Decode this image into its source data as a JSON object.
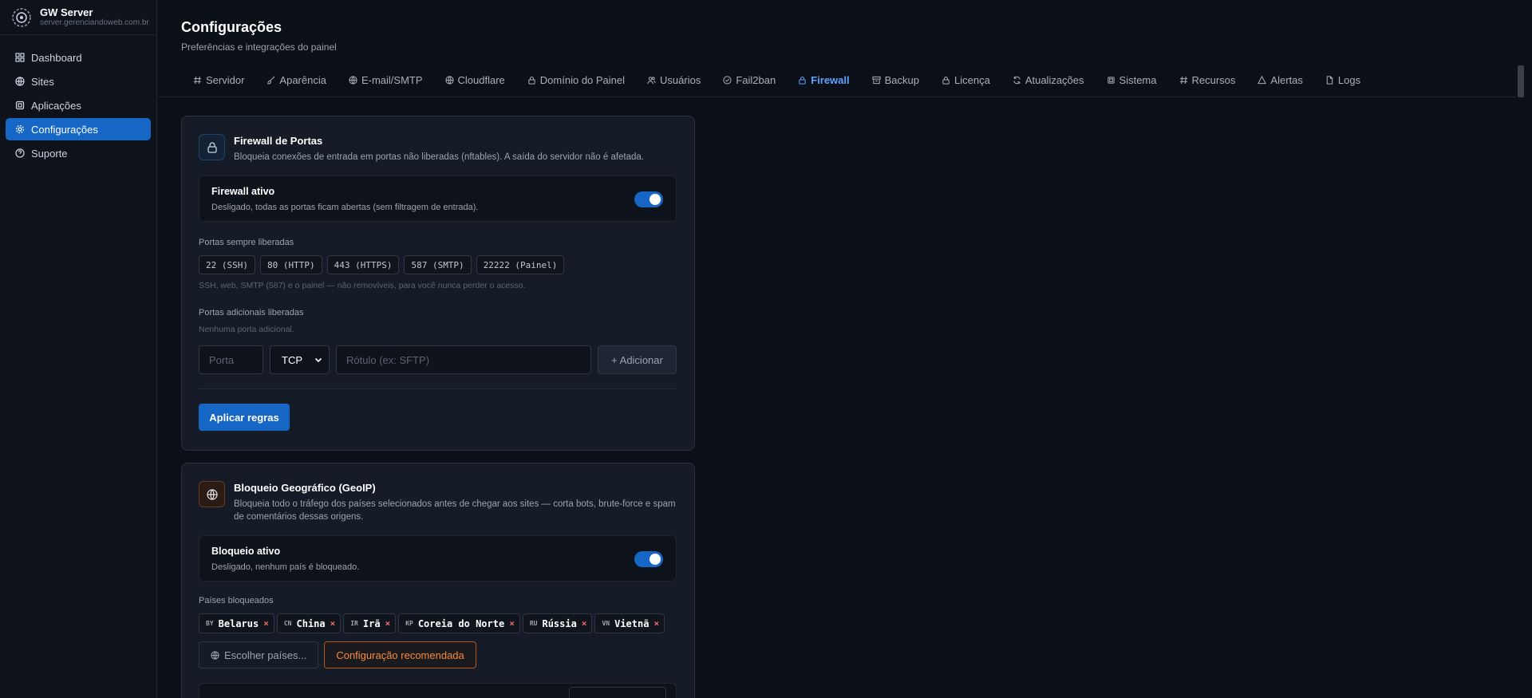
{
  "brand": {
    "name": "GW Server",
    "host": "server.gerenciandoweb.com.br"
  },
  "nav": [
    {
      "label": "Dashboard",
      "icon": "grid-icon",
      "active": false
    },
    {
      "label": "Sites",
      "icon": "globe-icon",
      "active": false
    },
    {
      "label": "Aplicações",
      "icon": "box-icon",
      "active": false
    },
    {
      "label": "Configurações",
      "icon": "gear-icon",
      "active": true
    },
    {
      "label": "Suporte",
      "icon": "help-icon",
      "active": false
    }
  ],
  "header": {
    "title": "Configurações",
    "subtitle": "Preferências e integrações do painel"
  },
  "tabs": [
    {
      "label": "Servidor",
      "icon": "hash-icon"
    },
    {
      "label": "Aparência",
      "icon": "brush-icon"
    },
    {
      "label": "E-mail/SMTP",
      "icon": "globe-icon"
    },
    {
      "label": "Cloudflare",
      "icon": "globe-icon"
    },
    {
      "label": "Domínio do Painel",
      "icon": "lock-icon"
    },
    {
      "label": "Usuários",
      "icon": "users-icon"
    },
    {
      "label": "Fail2ban",
      "icon": "shield-icon"
    },
    {
      "label": "Firewall",
      "icon": "lock-icon",
      "active": true
    },
    {
      "label": "Backup",
      "icon": "archive-icon"
    },
    {
      "label": "Licença",
      "icon": "lock-icon"
    },
    {
      "label": "Atualizações",
      "icon": "refresh-icon"
    },
    {
      "label": "Sistema",
      "icon": "chip-icon"
    },
    {
      "label": "Recursos",
      "icon": "hash-icon"
    },
    {
      "label": "Alertas",
      "icon": "alert-icon"
    },
    {
      "label": "Logs",
      "icon": "file-icon"
    }
  ],
  "firewall": {
    "title": "Firewall de Portas",
    "description": "Bloqueia conexões de entrada em portas não liberadas (nftables). A saída do servidor não é afetada.",
    "toggle_title": "Firewall ativo",
    "toggle_desc": "Desligado, todas as portas ficam abertas (sem filtragem de entrada).",
    "always_label": "Portas sempre liberadas",
    "always_ports": [
      "22 (SSH)",
      "80 (HTTP)",
      "443 (HTTPS)",
      "587 (SMTP)",
      "22222 (Painel)"
    ],
    "always_hint": "SSH, web, SMTP (587) e o painel — não removíveis, para você nunca perder o acesso.",
    "extra_label": "Portas adicionais liberadas",
    "extra_empty": "Nenhuma porta adicional.",
    "port_placeholder": "Porta",
    "protocol": "TCP",
    "label_placeholder": "Rótulo (ex: SFTP)",
    "add_label": "+ Adicionar",
    "apply_label": "Aplicar regras"
  },
  "geoip": {
    "title": "Bloqueio Geográfico (GeoIP)",
    "description": "Bloqueia todo o tráfego dos países selecionados antes de chegar aos sites — corta bots, brute-force e spam de comentários dessas origens.",
    "toggle_title": "Bloqueio ativo",
    "toggle_desc": "Desligado, nenhum país é bloqueado.",
    "countries_label": "Países bloqueados",
    "countries": [
      {
        "code": "BY",
        "name": "Belarus"
      },
      {
        "code": "CN",
        "name": "China"
      },
      {
        "code": "IR",
        "name": "Irã"
      },
      {
        "code": "KP",
        "name": "Coreia do Norte"
      },
      {
        "code": "RU",
        "name": "Rússia"
      },
      {
        "code": "VN",
        "name": "Vietnã"
      }
    ],
    "choose_label": "Escolher países...",
    "recommended_label": "Configuração recomendada"
  },
  "colors": {
    "accent": "#1666c5",
    "active_tab": "#5ea2ff",
    "orange": "#f6893a",
    "remove": "#f06b6b"
  }
}
